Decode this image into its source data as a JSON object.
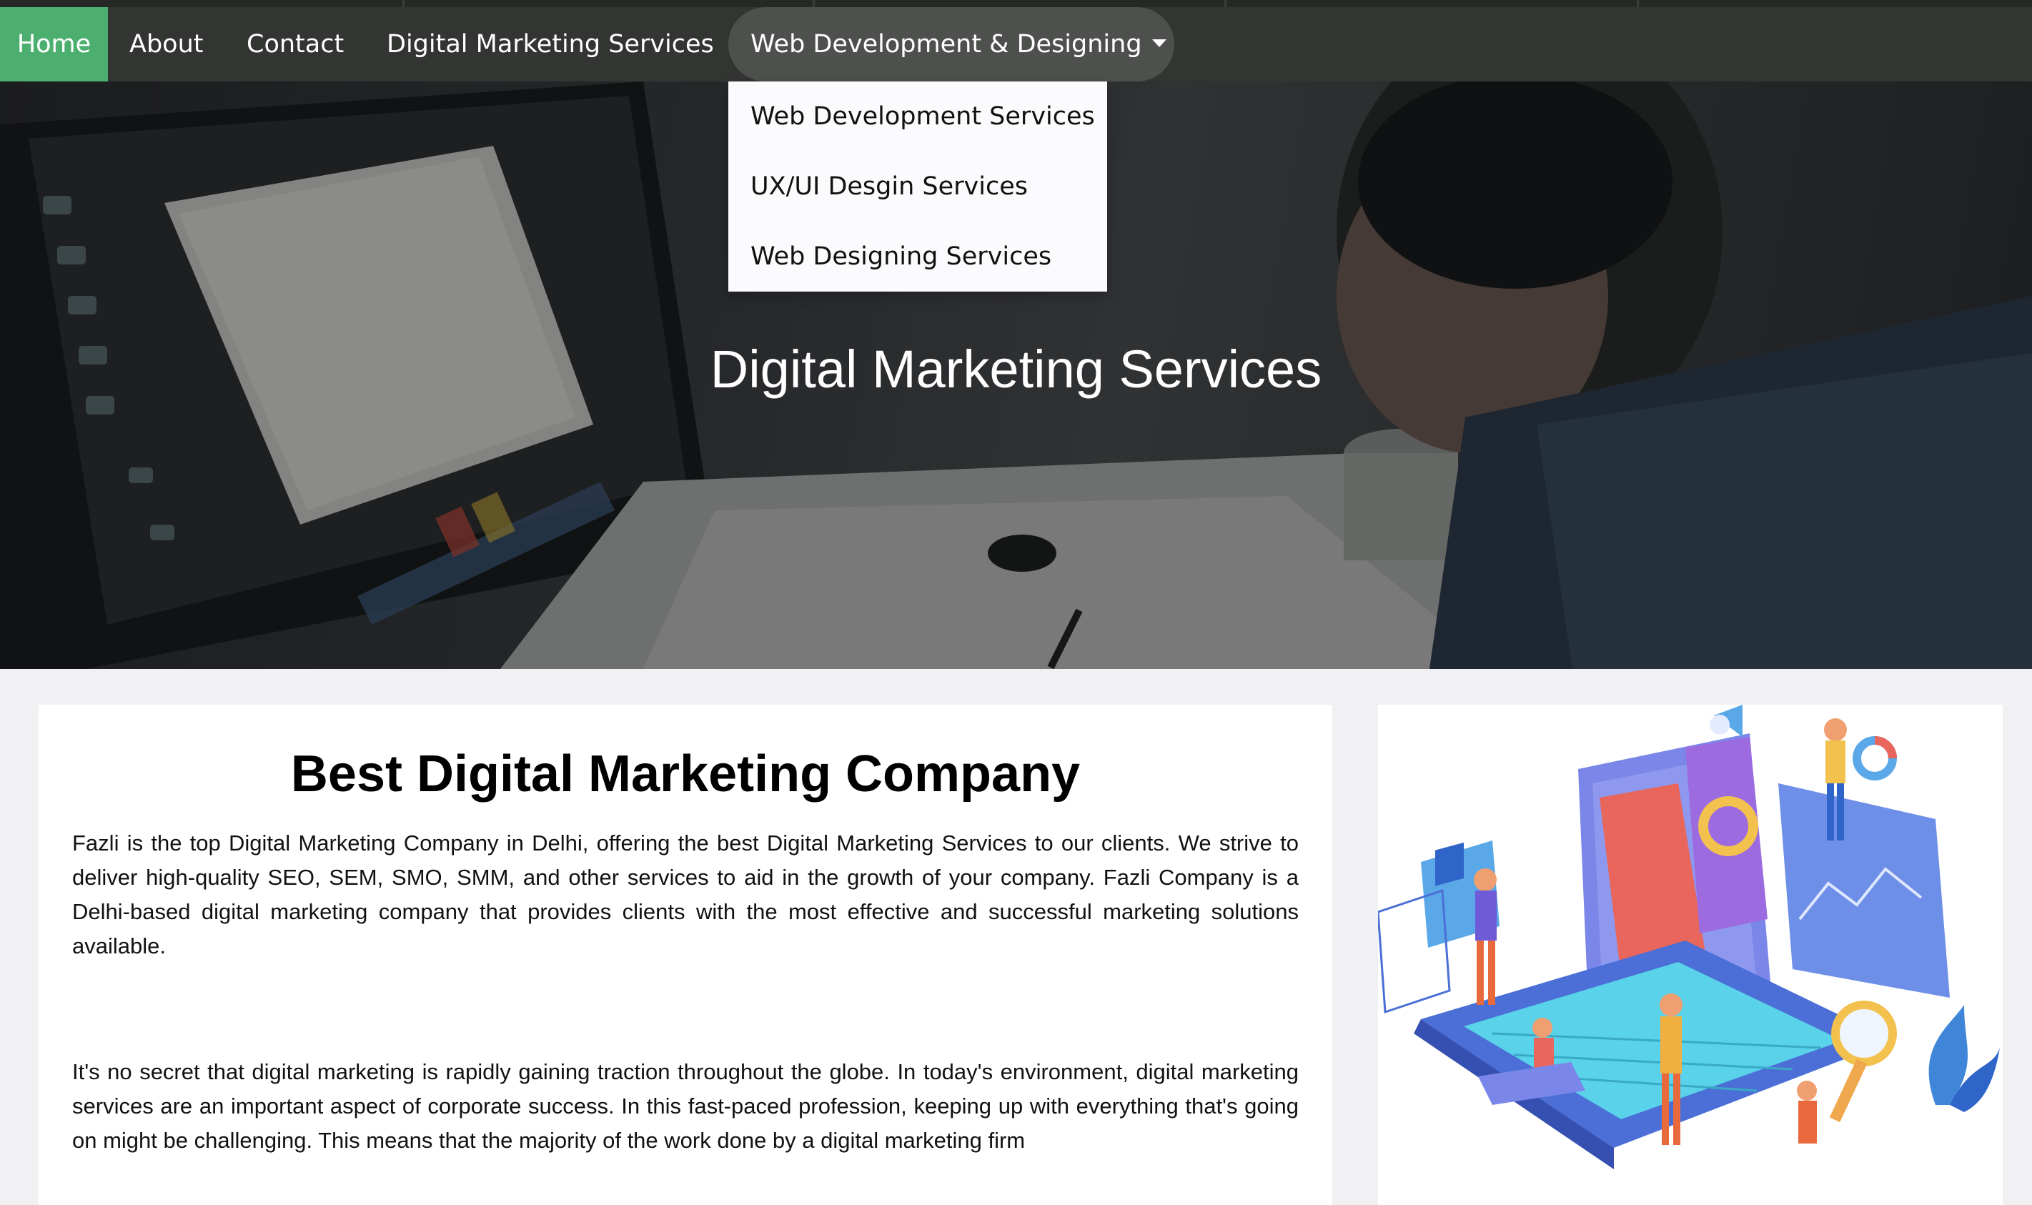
{
  "nav": {
    "home": "Home",
    "about": "About",
    "contact": "Contact",
    "digital_marketing": "Digital Marketing Services",
    "web_dev_dropdown": "Web Development & Designing"
  },
  "dropdown": {
    "items": [
      "Web Development Services",
      "UX/UI Desgin Services",
      "Web Designing Services"
    ]
  },
  "hero": {
    "title": "Digital Marketing Services"
  },
  "content": {
    "heading": "Best Digital Marketing Company",
    "paragraph1": "Fazli is the top Digital Marketing Company in Delhi, offering the best Digital Marketing Services to our clients. We strive to deliver high-quality SEO, SEM, SMO, SMM, and other services to aid in the growth of your company. Fazli Company is a Delhi-based digital marketing company that provides clients with the most effective and successful marketing solutions available.",
    "paragraph2": "It's no secret that digital marketing is rapidly gaining traction throughout the globe. In today's environment, digital marketing services are an important aspect of corporate success. In this fast-paced profession, keeping up with everything that's going on might be challenging. This means that the majority of the work done by a digital marketing firm"
  },
  "colors": {
    "nav_bg": "#333533",
    "nav_active": "#4caf6f",
    "dropdown_hover": "#4e504e"
  },
  "icons": {
    "caret": "caret-down-icon"
  }
}
